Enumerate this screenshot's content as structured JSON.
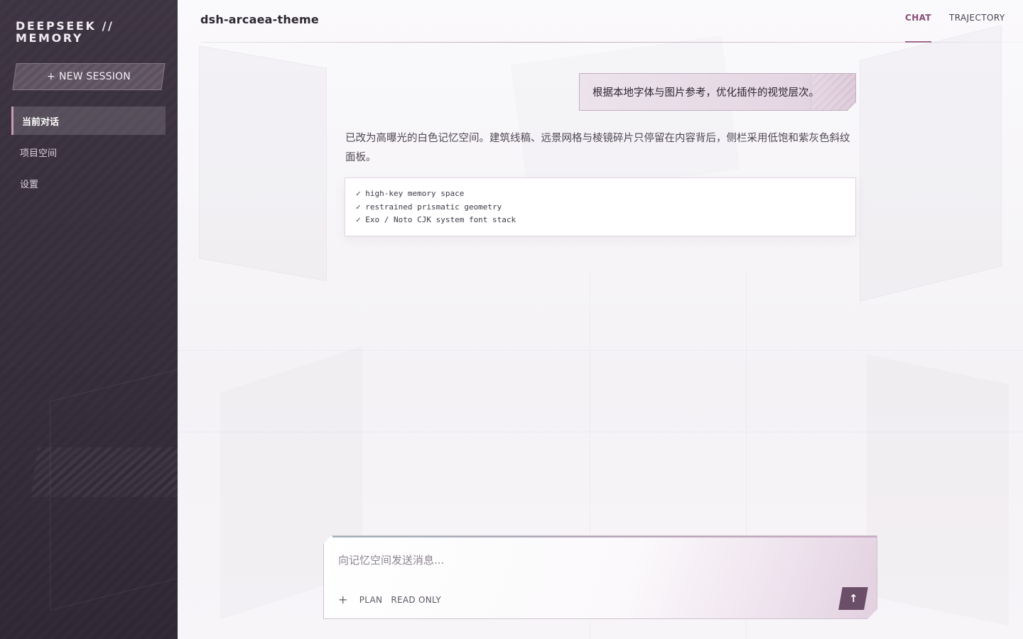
{
  "sidebar": {
    "brand_line1": "DEEPSEEK //",
    "brand_line2": "MEMORY",
    "new_session_label": "NEW SESSION",
    "new_session_icon": "+",
    "items": [
      {
        "label": "当前对话",
        "active": true
      },
      {
        "label": "项目空间",
        "active": false
      },
      {
        "label": "设置",
        "active": false
      }
    ]
  },
  "header": {
    "title": "dsh-arcaea-theme",
    "tabs": [
      {
        "label": "CHAT",
        "active": true
      },
      {
        "label": "TRAJECTORY",
        "active": false
      }
    ]
  },
  "conversation": {
    "user_message": "根据本地字体与图片参考，优化插件的视觉层次。",
    "assistant_message": "已改为高曝光的白色记忆空间。建筑线稿、远景网格与棱镜碎片只停留在内容背后，侧栏采用低饱和紫灰色斜纹面板。",
    "code_lines": [
      "✓ high-key memory space",
      "✓ restrained prismatic geometry",
      "✓ Exo / Noto CJK system font stack"
    ]
  },
  "composer": {
    "placeholder": "向记忆空间发送消息...",
    "value": "",
    "plus_icon": "+",
    "plan_label": "PLAN",
    "read_only_label": "READ ONLY",
    "send_icon": "↑"
  },
  "colors": {
    "sidebar_bg": "#3d3442",
    "accent": "#8a4e78",
    "send_button": "#6b4e68",
    "user_bubble": "#e4d6e2"
  }
}
